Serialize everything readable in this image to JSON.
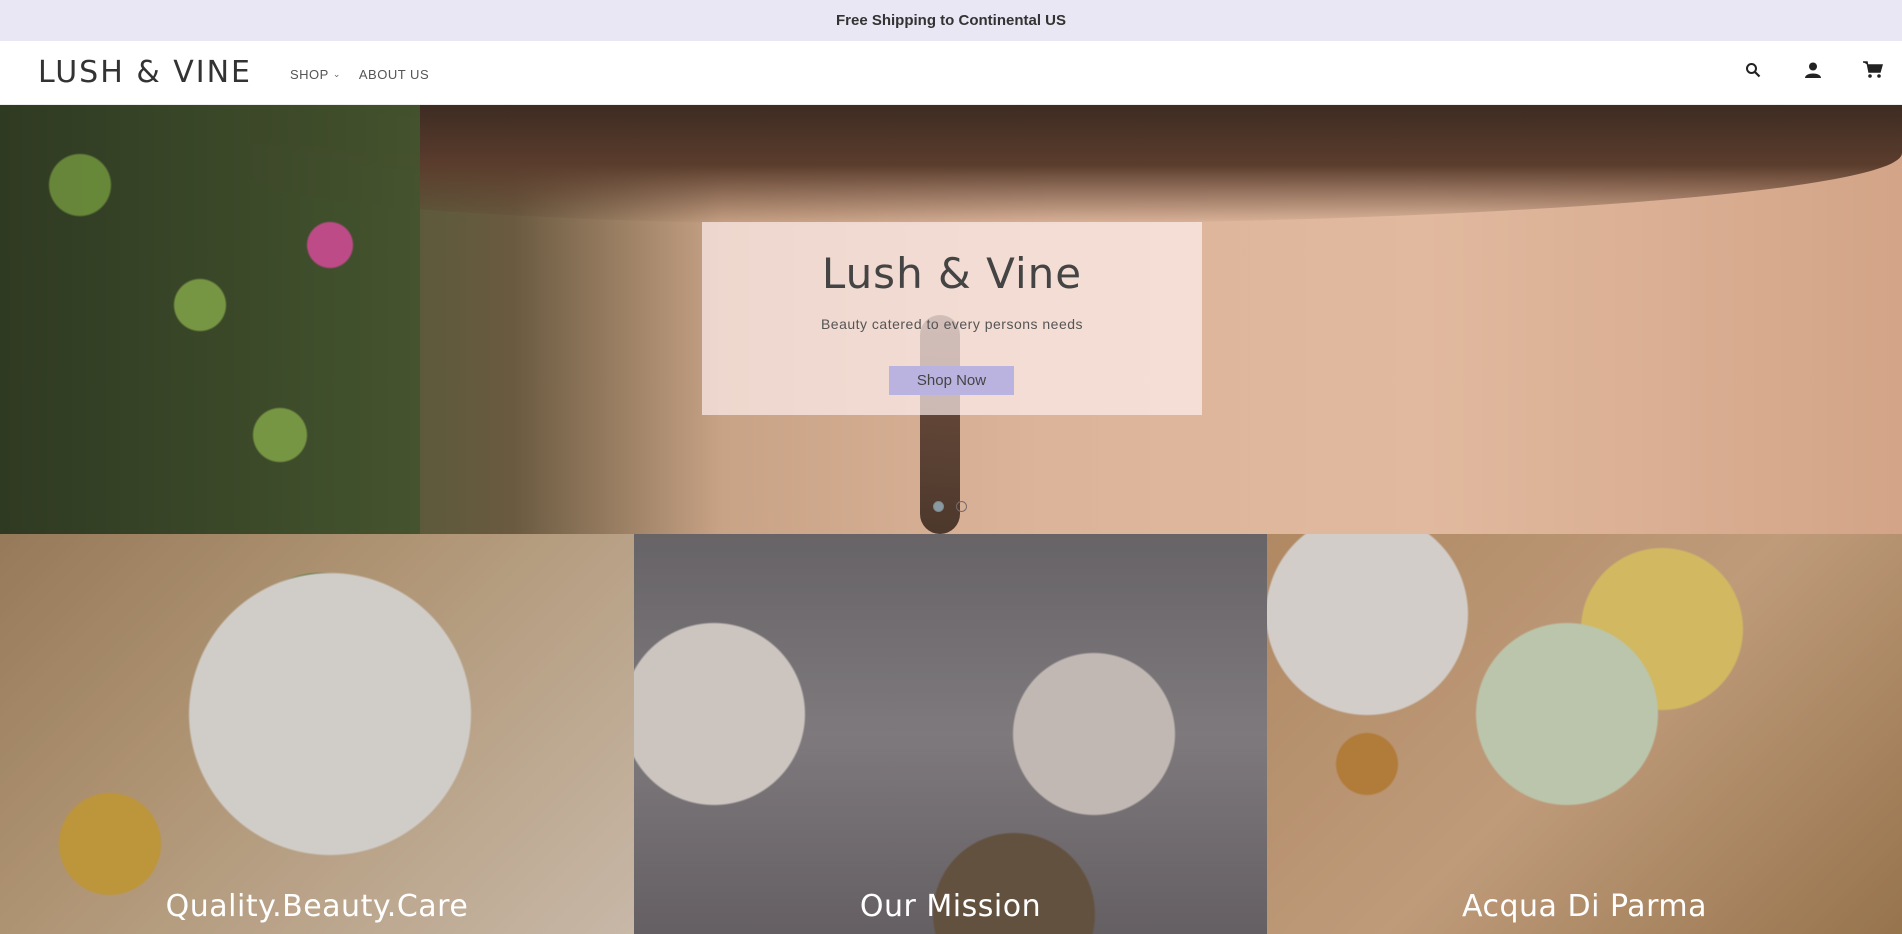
{
  "announcement": "Free Shipping to Continental US",
  "header": {
    "logo": "LUSH & VINE",
    "nav": [
      {
        "label": "SHOP",
        "has_dropdown": true
      },
      {
        "label": "ABOUT US",
        "has_dropdown": false
      }
    ],
    "icons": [
      "search-icon",
      "account-icon",
      "cart-icon"
    ]
  },
  "hero": {
    "title": "Lush & Vine",
    "subtitle": "Beauty catered to every persons needs",
    "button_label": "Shop Now",
    "slides_count": 2,
    "active_slide": 1
  },
  "tiles": [
    {
      "label": "Quality.Beauty.Care"
    },
    {
      "label": "Our Mission"
    },
    {
      "label": "Acqua Di Parma"
    }
  ],
  "colors": {
    "announcement_bg": "#e9e7f3",
    "button_bg": "#bab3df"
  }
}
